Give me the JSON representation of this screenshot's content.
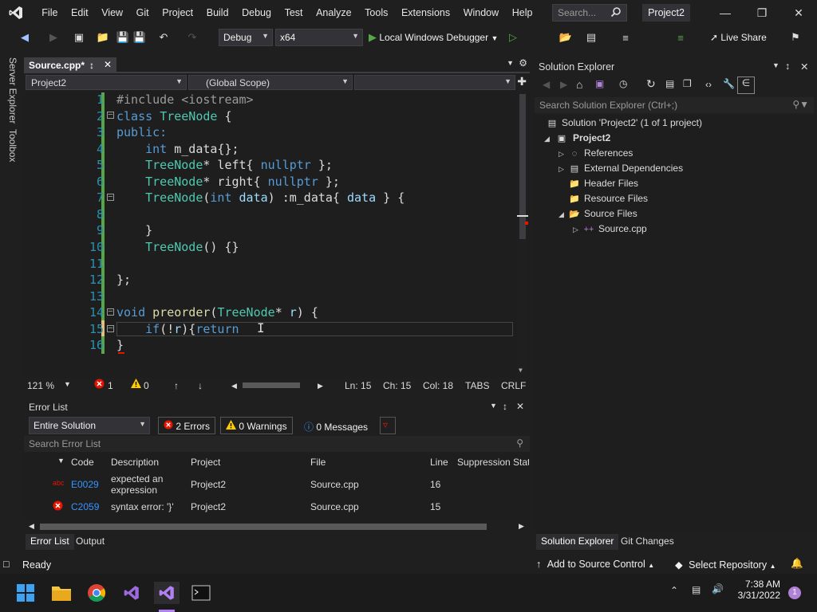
{
  "menu": [
    "File",
    "Edit",
    "View",
    "Git",
    "Project",
    "Build",
    "Debug",
    "Test",
    "Analyze",
    "Tools",
    "Extensions",
    "Window",
    "Help"
  ],
  "search_placeholder": "Search...",
  "project_name": "Project2",
  "toolbar": {
    "config": "Debug",
    "platform": "x64",
    "debugger": "Local Windows Debugger",
    "live_share": "Live Share"
  },
  "left_strip": [
    "Server Explorer",
    "Toolbox"
  ],
  "editor": {
    "tab": "Source.cpp*",
    "nav_project": "Project2",
    "nav_scope": "(Global Scope)",
    "line_numbers": [
      "1",
      "2",
      "3",
      "4",
      "5",
      "6",
      "7",
      "8",
      "9",
      "10",
      "11",
      "12",
      "13",
      "14",
      "15",
      "16"
    ],
    "lines": [
      "#include <iostream>",
      "class TreeNode {",
      "public:",
      "    int m_data{};",
      "    TreeNode* left{ nullptr };",
      "    TreeNode* right{ nullptr };",
      "    TreeNode(int data) :m_data{ data } {",
      "",
      "    }",
      "    TreeNode() {}",
      "",
      "};",
      "",
      "void preorder(TreeNode* r) {",
      "    if(!r){return ",
      "}"
    ],
    "status": {
      "zoom": "121 %",
      "errors": "1",
      "warnings": "0",
      "ln": "Ln: 15",
      "ch": "Ch: 15",
      "col": "Col: 18",
      "tabs": "TABS",
      "eol": "CRLF"
    }
  },
  "error_list": {
    "title": "Error List",
    "scope": "Entire Solution",
    "errors_btn": "2 Errors",
    "warnings_btn": "0 Warnings",
    "messages_btn": "0 Messages",
    "search_placeholder": "Search Error List",
    "columns": [
      "Code",
      "Description",
      "Project",
      "File",
      "Line",
      "Suppression State"
    ],
    "rows": [
      {
        "code": "E0029",
        "description": "expected an expression",
        "project": "Project2",
        "file": "Source.cpp",
        "line": "16"
      },
      {
        "code": "C2059",
        "description": "syntax error: '}'",
        "project": "Project2",
        "file": "Source.cpp",
        "line": "15"
      }
    ],
    "tabs": [
      "Error List",
      "Output"
    ]
  },
  "solution_explorer": {
    "title": "Solution Explorer",
    "search_placeholder": "Search Solution Explorer (Ctrl+;)",
    "items": [
      "Solution 'Project2' (1 of 1 project)",
      "Project2",
      "References",
      "External Dependencies",
      "Header Files",
      "Resource Files",
      "Source Files",
      "Source.cpp"
    ],
    "tabs": [
      "Solution Explorer",
      "Git Changes"
    ]
  },
  "statusbar": {
    "ready": "Ready",
    "add_source": "Add to Source Control",
    "select_repo": "Select Repository"
  },
  "taskbar": {
    "time": "7:38 AM",
    "date": "3/31/2022",
    "notifications": "1"
  },
  "colors": {
    "accent": "#007acc",
    "error": "#e51400",
    "warning": "#ffcc00",
    "keyword": "#569cd6",
    "type": "#4ec9b0",
    "line_number": "#2b91af"
  }
}
